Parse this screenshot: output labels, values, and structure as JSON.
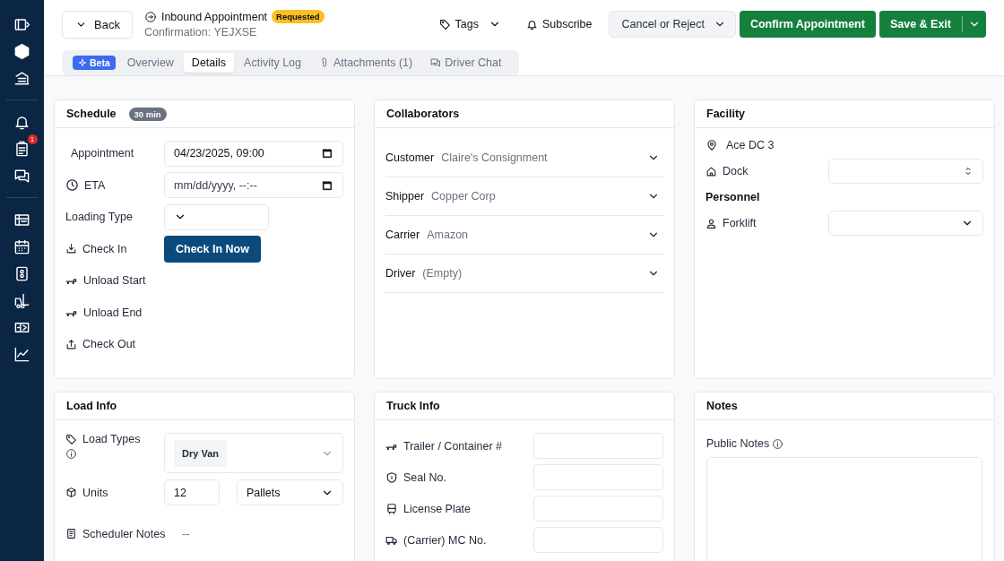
{
  "sidebar": {
    "notification_badge": "1"
  },
  "header": {
    "back_button": "Back",
    "title": "Inbound Appointment",
    "status": "Requested",
    "confirmation": "Confirmation: YEJXSE",
    "tags_button": "Tags",
    "subscribe_button": "Subscribe",
    "cancel_button": "Cancel or Reject",
    "confirm_button": "Confirm Appointment",
    "save_button": "Save & Exit"
  },
  "beta_badge": "Beta",
  "tabs": [
    {
      "label": "Overview",
      "selected": false
    },
    {
      "label": "Details",
      "selected": true
    },
    {
      "label": "Activity Log",
      "selected": false
    },
    {
      "label": "Attachments (1)",
      "selected": false
    },
    {
      "label": "Driver Chat",
      "selected": false
    }
  ],
  "schedule": {
    "title": "Schedule",
    "duration": "30 min",
    "rows": [
      {
        "label": "Appointment",
        "kind": "datetime",
        "value": "04/23/2025, 09:00"
      },
      {
        "label": "ETA",
        "kind": "datetime",
        "placeholder": "mm/dd/yyyy, --:--"
      },
      {
        "label": "Loading Type",
        "kind": "select"
      },
      {
        "label": "Check In",
        "kind": "button",
        "button": "Check In Now"
      },
      {
        "label": "Unload Start",
        "kind": "empty"
      },
      {
        "label": "Unload End",
        "kind": "empty"
      },
      {
        "label": "Check Out",
        "kind": "empty"
      }
    ]
  },
  "collaborators": {
    "title": "Collaborators",
    "items": [
      {
        "label": "Customer",
        "value": "Claire's Consignment"
      },
      {
        "label": "Shipper",
        "value": "Copper Corp"
      },
      {
        "label": "Carrier",
        "value": "Amazon"
      },
      {
        "label": "Driver",
        "value": "(Empty)"
      }
    ]
  },
  "facility": {
    "title": "Facility",
    "location": "Ace DC 3",
    "dock_label": "Dock",
    "personnel_heading": "Personnel",
    "forklift_label": "Forklift"
  },
  "load_info": {
    "title": "Load Info",
    "load_types_label": "Load Types",
    "load_type_chip": "Dry Van",
    "units_label": "Units",
    "units_value": "12",
    "unit_type": "Pallets",
    "scheduler_notes_label": "Scheduler Notes",
    "scheduler_notes_value": "--"
  },
  "truck_info": {
    "title": "Truck Info",
    "fields": [
      "Trailer / Container #",
      "Seal No.",
      "License Plate",
      "(Carrier) MC No."
    ]
  },
  "notes": {
    "title": "Notes",
    "public_notes_label": "Public Notes"
  }
}
